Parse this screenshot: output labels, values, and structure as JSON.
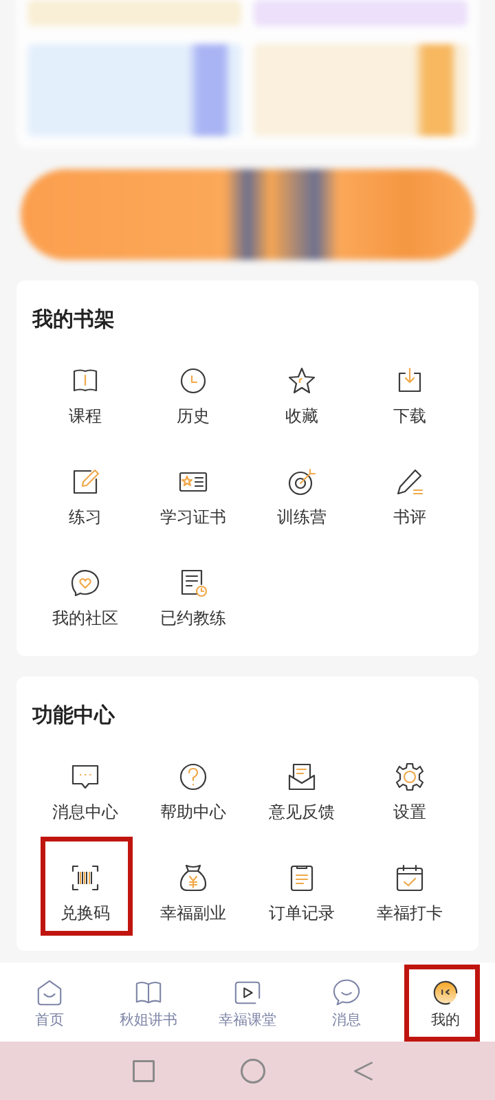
{
  "bookshelf": {
    "title": "我的书架",
    "items": [
      {
        "label": "课程",
        "highlighted": false
      },
      {
        "label": "历史",
        "highlighted": false
      },
      {
        "label": "收藏",
        "highlighted": false
      },
      {
        "label": "下载",
        "highlighted": false
      },
      {
        "label": "练习",
        "highlighted": false
      },
      {
        "label": "学习证书",
        "highlighted": false
      },
      {
        "label": "训练营",
        "highlighted": false
      },
      {
        "label": "书评",
        "highlighted": false
      },
      {
        "label": "我的社区",
        "highlighted": false
      },
      {
        "label": "已约教练",
        "highlighted": false
      }
    ]
  },
  "function_center": {
    "title": "功能中心",
    "items": [
      {
        "label": "消息中心",
        "highlighted": false
      },
      {
        "label": "帮助中心",
        "highlighted": false
      },
      {
        "label": "意见反馈",
        "highlighted": false
      },
      {
        "label": "设置",
        "highlighted": false
      },
      {
        "label": "兑换码",
        "highlighted": true
      },
      {
        "label": "幸福副业",
        "highlighted": false
      },
      {
        "label": "订单记录",
        "highlighted": false
      },
      {
        "label": "幸福打卡",
        "highlighted": false
      }
    ]
  },
  "tabs": [
    {
      "label": "首页",
      "selected": false,
      "highlighted": false
    },
    {
      "label": "秋姐讲书",
      "selected": false,
      "highlighted": false
    },
    {
      "label": "幸福课堂",
      "selected": false,
      "highlighted": false
    },
    {
      "label": "消息",
      "selected": false,
      "highlighted": false
    },
    {
      "label": "我的",
      "selected": true,
      "highlighted": true
    }
  ]
}
